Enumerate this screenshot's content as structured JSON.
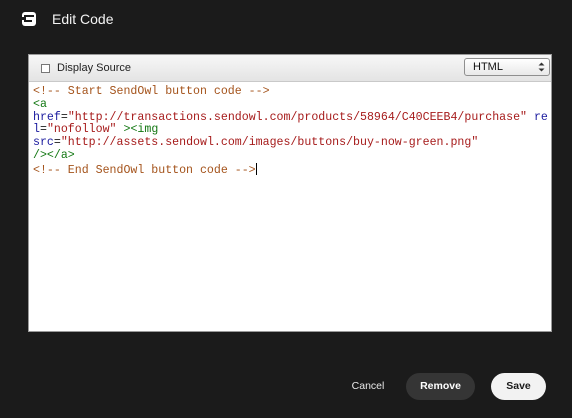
{
  "dialog": {
    "title": "Edit Code",
    "logo_icon": "sendowl-logo-icon"
  },
  "toolbar": {
    "display_source_label": "Display Source",
    "display_source_checked": false,
    "mode_select_value": "HTML"
  },
  "code": {
    "comment_start": "<!-- Start SendOwl button code -->",
    "tag_a_open": "<a",
    "href_attr": "href",
    "href_value": "\"http://transactions.sendowl.com/products/58964/C40CEEB4/purchase\"",
    "rel_attr": "rel",
    "rel_value": "\"nofollow\"",
    "tag_a_close": "><img",
    "src_attr": "src",
    "src_value": "\"http://assets.sendowl.com/images/buttons/buy-now-green.png\"",
    "tag_end": "/></a>",
    "comment_end": "<!-- End SendOwl button code -->"
  },
  "footer": {
    "cancel_label": "Cancel",
    "remove_label": "Remove",
    "save_label": "Save"
  },
  "colors": {
    "background": "#1b1b1b",
    "comment": "#a4531b",
    "tag": "#117711",
    "attribute": "#1a1a9e",
    "string": "#a61b1b"
  }
}
